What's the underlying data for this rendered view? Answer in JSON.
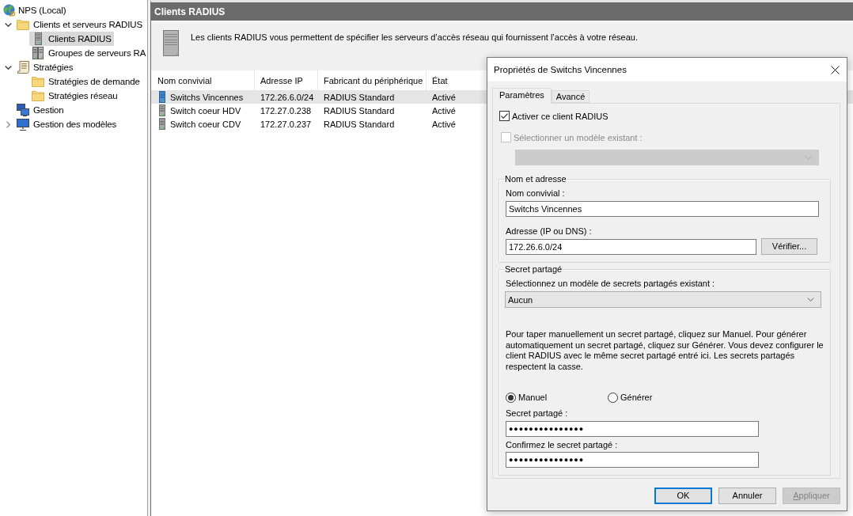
{
  "tree": {
    "label": "NPS (Local)",
    "kind": "root",
    "selected": false,
    "children": [
      {
        "label": "Clients et serveurs RADIUS",
        "kind": "folder",
        "expanded": true,
        "selected": false,
        "children": [
          {
            "label": "Clients RADIUS",
            "kind": "clients",
            "selected": true
          },
          {
            "label": "Groupes de serveurs RA",
            "kind": "server-groups",
            "selected": false
          }
        ]
      },
      {
        "label": "Stratégies",
        "kind": "policies",
        "expanded": true,
        "selected": false,
        "children": [
          {
            "label": "Stratégies de demande",
            "kind": "folder",
            "selected": false
          },
          {
            "label": "Stratégies réseau",
            "kind": "folder",
            "selected": false
          }
        ]
      },
      {
        "label": "Gestion",
        "kind": "management",
        "selected": false
      },
      {
        "label": "Gestion des modèles",
        "kind": "templates",
        "expanded": false,
        "selected": false
      }
    ]
  },
  "pane": {
    "title": "Clients RADIUS",
    "description": "Les clients RADIUS vous permettent de spécifier les serveurs d’accès réseau qui fournissent l’accès à votre réseau.",
    "table": {
      "columns": [
        "Nom convivial",
        "Adresse IP",
        "Fabricant du périphérique",
        "État"
      ],
      "rows": [
        {
          "cells": [
            "Switchs Vincennes",
            "172.26.6.0/24",
            "RADIUS Standard",
            "Activé"
          ],
          "selected": true
        },
        {
          "cells": [
            "Switch coeur HDV",
            "172.27.0.238",
            "RADIUS Standard",
            "Activé"
          ],
          "selected": false
        },
        {
          "cells": [
            "Switch coeur CDV",
            "172.27.0.237",
            "RADIUS Standard",
            "Activé"
          ],
          "selected": false
        }
      ]
    }
  },
  "dialog": {
    "title": "Propriétés de Switchs Vincennes",
    "tabs": [
      {
        "label": "Paramètres",
        "selected": true
      },
      {
        "label": "Avancé",
        "selected": false
      }
    ],
    "enable_client": {
      "label": "Activer ce client RADIUS",
      "checked": true,
      "disabled": false
    },
    "use_template": {
      "label": "Sélectionner un modèle existant :",
      "checked": false,
      "disabled": true
    },
    "template_select": {
      "disabled": true
    },
    "name_address": {
      "title": "Nom et adresse",
      "name_label": "Nom convivial :",
      "name_value": "Switchs Vincennes",
      "address_label": "Adresse (IP ou DNS) :",
      "address_value": "172.26.6.0/24",
      "verify_button": "Vérifier..."
    },
    "shared_secret": {
      "title": "Secret partagé",
      "template_label": "Sélectionnez un modèle de secrets partagés existant :",
      "template_value": "Aucun",
      "help": "Pour taper manuellement un secret partagé, cliquez sur Manuel. Pour générer automatiquement un secret partagé, cliquez sur Générer. Vous devez configurer le client RADIUS avec le même secret partagé entré ici. Les secrets partagés respectent la casse.",
      "modes": [
        {
          "label": "Manuel",
          "selected": true
        },
        {
          "label": "Générer",
          "selected": false
        }
      ],
      "secret_label": "Secret partagé :",
      "secret_value": "●●●●●●●●●●●●●●●",
      "confirm_label": "Confirmez le secret partagé :",
      "confirm_value": "●●●●●●●●●●●●●●●"
    },
    "buttons": [
      {
        "label": "OK",
        "default": true,
        "disabled": false,
        "mnemonic": false
      },
      {
        "label": "Annuler",
        "default": false,
        "disabled": false,
        "mnemonic": false
      },
      {
        "label": "Appliquer",
        "default": false,
        "disabled": true,
        "mnemonic": true
      }
    ]
  }
}
